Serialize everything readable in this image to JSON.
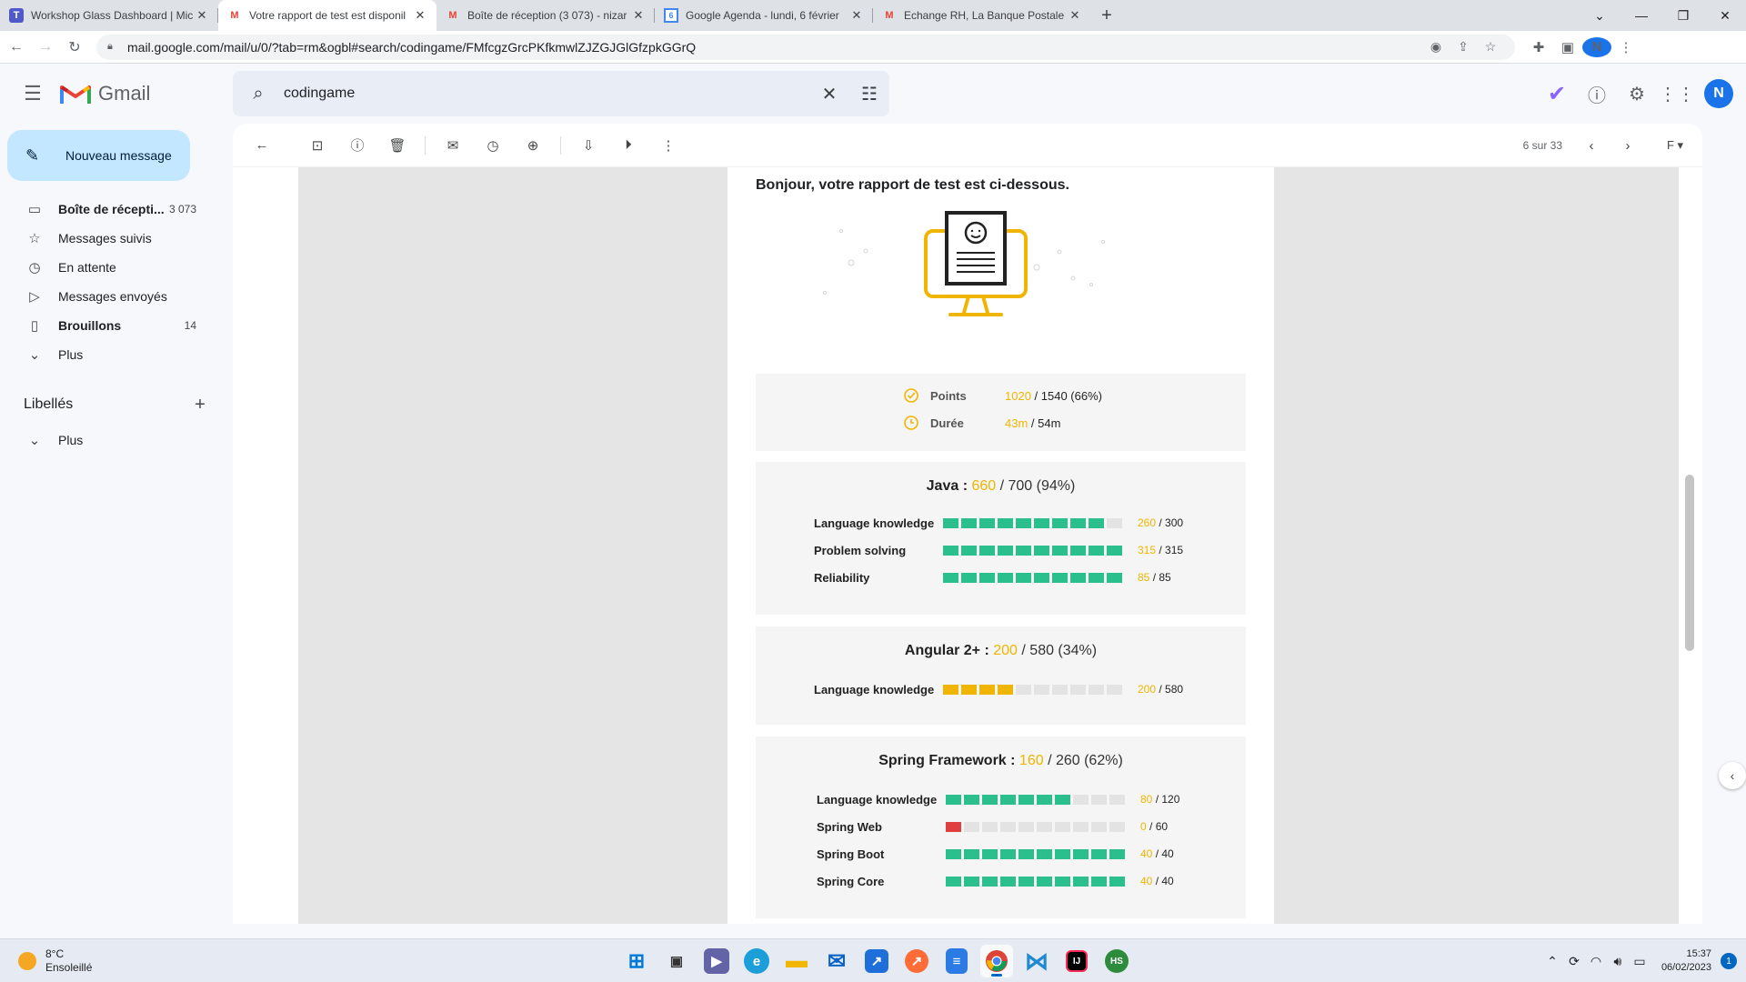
{
  "browser": {
    "tabs": [
      {
        "title": "Workshop Glass Dashboard | Mic",
        "favicon": "teams-icon",
        "active": false
      },
      {
        "title": "Votre rapport de test est disponil",
        "favicon": "gmail-icon",
        "active": true
      },
      {
        "title": "Boîte de réception (3 073) - nizar",
        "favicon": "gmail-icon",
        "active": false
      },
      {
        "title": "Google Agenda - lundi, 6 février",
        "favicon": "calendar-icon",
        "active": false
      },
      {
        "title": "Echange RH, La Banque Postale -",
        "favicon": "gmail-icon",
        "active": false
      }
    ],
    "url": "mail.google.com/mail/u/0/?tab=rm&ogbl#search/codingame/FMfcgzGrcPKfkmwlZJZGJGlGfzpkGGrQ",
    "profile_initial": "N"
  },
  "gmail": {
    "logo_text": "Gmail",
    "search_value": "codingame",
    "profile_initial": "N",
    "compose_label": "Nouveau message",
    "nav": [
      {
        "label": "Boîte de récepti...",
        "count": "3 073",
        "icon": "inbox-icon",
        "bold": true
      },
      {
        "label": "Messages suivis",
        "count": "",
        "icon": "star-icon",
        "bold": false
      },
      {
        "label": "En attente",
        "count": "",
        "icon": "clock-icon",
        "bold": false
      },
      {
        "label": "Messages envoyés",
        "count": "",
        "icon": "send-icon",
        "bold": false
      },
      {
        "label": "Brouillons",
        "count": "14",
        "icon": "draft-icon",
        "bold": true
      },
      {
        "label": "Plus",
        "count": "",
        "icon": "chevron-down-icon",
        "bold": false
      }
    ],
    "labels_heading": "Libellés",
    "labels_more": "Plus",
    "pager": "6 sur 33",
    "lang_selector": "F"
  },
  "email": {
    "greeting": "Bonjour, votre rapport de test est ci-dessous.",
    "summary": {
      "points_label": "Points",
      "points_value": "1020",
      "points_total": " / 1540 (66%)",
      "duration_label": "Durée",
      "duration_value": "43m",
      "duration_total": " / 54m"
    },
    "sections": [
      {
        "name": "Java",
        "score": "660",
        "rest": " / 700 (94%)",
        "skills": [
          {
            "name": "Language knowledge",
            "score": "260",
            "total": " / 300",
            "level": 0.9,
            "color": "green"
          },
          {
            "name": "Problem solving",
            "score": "315",
            "total": " / 315",
            "level": 1.0,
            "color": "green"
          },
          {
            "name": "Reliability",
            "score": "85",
            "total": " / 85",
            "level": 1.0,
            "color": "green"
          }
        ]
      },
      {
        "name": "Angular 2+",
        "score": "200",
        "rest": " / 580 (34%)",
        "skills": [
          {
            "name": "Language knowledge",
            "score": "200",
            "total": " / 580",
            "level": 0.4,
            "color": "yellow"
          }
        ]
      },
      {
        "name": "Spring Framework",
        "score": "160",
        "rest": " / 260 (62%)",
        "skills": [
          {
            "name": "Language knowledge",
            "score": "80",
            "total": " / 120",
            "level": 0.7,
            "color": "green"
          },
          {
            "name": "Spring Web",
            "score": "0",
            "total": " / 60",
            "level": 0.1,
            "color": "red"
          },
          {
            "name": "Spring Boot",
            "score": "40",
            "total": " / 40",
            "level": 1.0,
            "color": "green"
          },
          {
            "name": "Spring Core",
            "score": "40",
            "total": " / 40",
            "level": 1.0,
            "color": "green"
          }
        ]
      }
    ],
    "colors": {
      "accent": "#f0b500",
      "good": "#2bbf8e",
      "bad": "#e03f3f",
      "empty": "#e3e3e3"
    }
  },
  "taskbar": {
    "weather_temp": "8°C",
    "weather_desc": "Ensoleillé",
    "time": "15:37",
    "date": "06/02/2023",
    "notifications": "1"
  }
}
